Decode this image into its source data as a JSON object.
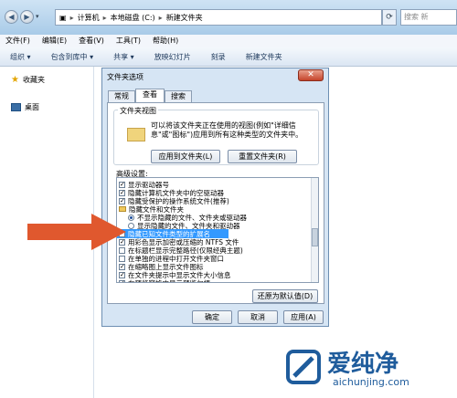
{
  "explorer": {
    "address": [
      "计算机",
      "本地磁盘 (C:)",
      "新建文件夹"
    ],
    "search_placeholder": "搜索 新",
    "menu": [
      "文件(F)",
      "编辑(E)",
      "查看(V)",
      "工具(T)",
      "帮助(H)"
    ],
    "toolbar": [
      "组织 ▾",
      "包含到库中 ▾",
      "共享 ▾",
      "放映幻灯片",
      "刻录",
      "新建文件夹"
    ],
    "nav": {
      "favorites": "收藏夹",
      "desktop": "桌面"
    }
  },
  "dialog": {
    "title": "文件夹选项",
    "tabs": [
      "常规",
      "查看",
      "搜索"
    ],
    "selected_tab": "查看",
    "folder_view_label": "文件夹视图",
    "folder_view_desc": "可以将该文件夹正在使用的视图(例如\"详细信息\"或\"图标\")应用到所有这种类型的文件夹中。",
    "apply_button": "应用到文件夹(L)",
    "reset_folders_button": "重置文件夹(R)",
    "advanced_label": "高级设置:",
    "settings": [
      {
        "type": "checkbox",
        "checked": true,
        "text": "显示驱动器号",
        "indent": 0
      },
      {
        "type": "checkbox",
        "checked": true,
        "text": "隐藏计算机文件夹中的空驱动器",
        "indent": 0
      },
      {
        "type": "checkbox",
        "checked": true,
        "text": "隐藏受保护的操作系统文件(推荐)",
        "indent": 0
      },
      {
        "type": "folder",
        "checked": false,
        "text": "隐藏文件和文件夹",
        "indent": 0
      },
      {
        "type": "radio",
        "checked": true,
        "text": "不显示隐藏的文件、文件夹或驱动器",
        "indent": 1
      },
      {
        "type": "radio",
        "checked": false,
        "text": "显示隐藏的文件、文件夹和驱动器",
        "indent": 1
      },
      {
        "type": "checkbox",
        "checked": false,
        "text": "隐藏已知文件类型的扩展名",
        "indent": 0,
        "highlight": true
      },
      {
        "type": "checkbox",
        "checked": true,
        "text": "用彩色显示加密或压缩的 NTFS 文件",
        "indent": 0
      },
      {
        "type": "checkbox",
        "checked": false,
        "text": "在标题栏显示完整路径(仅限经典主题)",
        "indent": 0
      },
      {
        "type": "checkbox",
        "checked": false,
        "text": "在单独的进程中打开文件夹窗口",
        "indent": 0
      },
      {
        "type": "checkbox",
        "checked": true,
        "text": "在缩略图上显示文件图标",
        "indent": 0
      },
      {
        "type": "checkbox",
        "checked": true,
        "text": "在文件夹提示中显示文件大小信息",
        "indent": 0
      },
      {
        "type": "checkbox",
        "checked": true,
        "text": "在预览窗格中显示预览句柄",
        "indent": 0
      }
    ],
    "restore_defaults_button": "还原为默认值(D)",
    "ok_button": "确定",
    "cancel_button": "取消",
    "apply_bottom_button": "应用(A)"
  },
  "watermark": {
    "text": "爱纯净",
    "url": "aichunjing.com"
  },
  "colors": {
    "arrow": "#e0582e",
    "highlight": "#3399ff"
  }
}
